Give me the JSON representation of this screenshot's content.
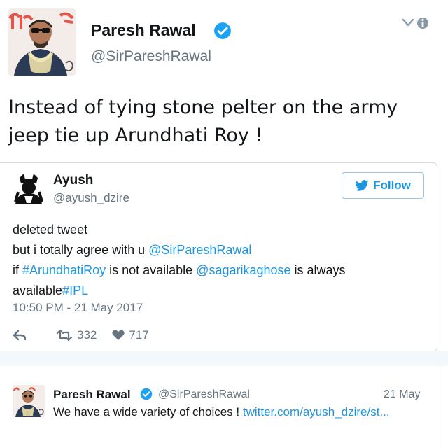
{
  "main_tweet": {
    "author_name": "Paresh Rawal",
    "author_handle": "@SirPareshRawal",
    "verified": true,
    "avatar_icon": "profile-photo",
    "menu_icon": "chevron-down-icon",
    "text_line1": "Instead of tying stone pelter on the army",
    "text_line2": "jeep tie up Arundhati Roy !"
  },
  "quoted_tweet": {
    "author_name": "Ayush",
    "author_handle": "@ayush_dzire",
    "follow_label": "Follow",
    "body": {
      "line1": "deleted tweet",
      "line2_prefix": "but i totally agree with u ",
      "line2_mention": "@SirPareshRawal",
      "line3_prefix": "if ",
      "line3_hashtag": "#ArundhatiRoy",
      "line3_middle": " is not available ",
      "line3_mention": "@sagarikaghose",
      "line3_suffix": " is always",
      "line4_prefix": "available",
      "line4_hashtag": "#IPL"
    },
    "timestamp": "10:50 PM - 21 May 2017",
    "retweet_count": "332",
    "like_count": "717"
  },
  "reply_tweet": {
    "author_name": "Paresh Rawal",
    "author_handle": "@SirPareshRawal",
    "date": "21 May",
    "text": "We have a wide variety of choices ! ",
    "link_text": "twitter.com/ayush_dzire/st..."
  },
  "colors": {
    "link_blue": "#1b95e0",
    "verified_blue": "#1da1f2",
    "secondary_text": "#66757f",
    "separator": "#f5f8fa"
  }
}
